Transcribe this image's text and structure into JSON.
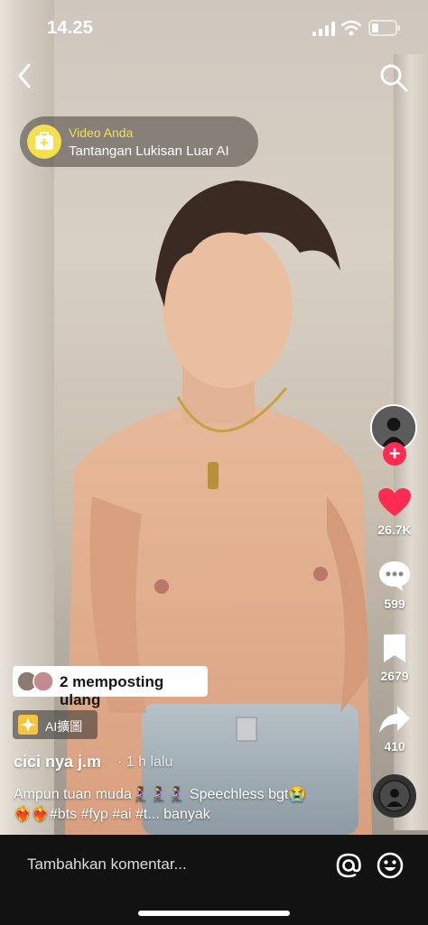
{
  "status": {
    "time": "14.25"
  },
  "challenge": {
    "label": "Video Anda",
    "title": "Tantangan Lukisan Luar AI"
  },
  "rail": {
    "likes": "26.7K",
    "comments": "599",
    "saves": "2679",
    "shares": "410"
  },
  "repost": {
    "text": "2 memposting ulang"
  },
  "ai_tag": {
    "text": "AI擴圖"
  },
  "post": {
    "username": "cici nya j.m",
    "time_ago": "· 1 h lalu",
    "caption": "Ampun tuan muda🧎‍♀️🧎‍♀️🧎‍♀️ Speechless bgt😭❤️‍🔥❤️‍🔥#bts #fyp #ai #t... banyak"
  },
  "comment_bar": {
    "placeholder": "Tambahkan komentar..."
  },
  "colors": {
    "accent_red": "#fe2c55",
    "challenge_yellow": "#f5df4d"
  }
}
